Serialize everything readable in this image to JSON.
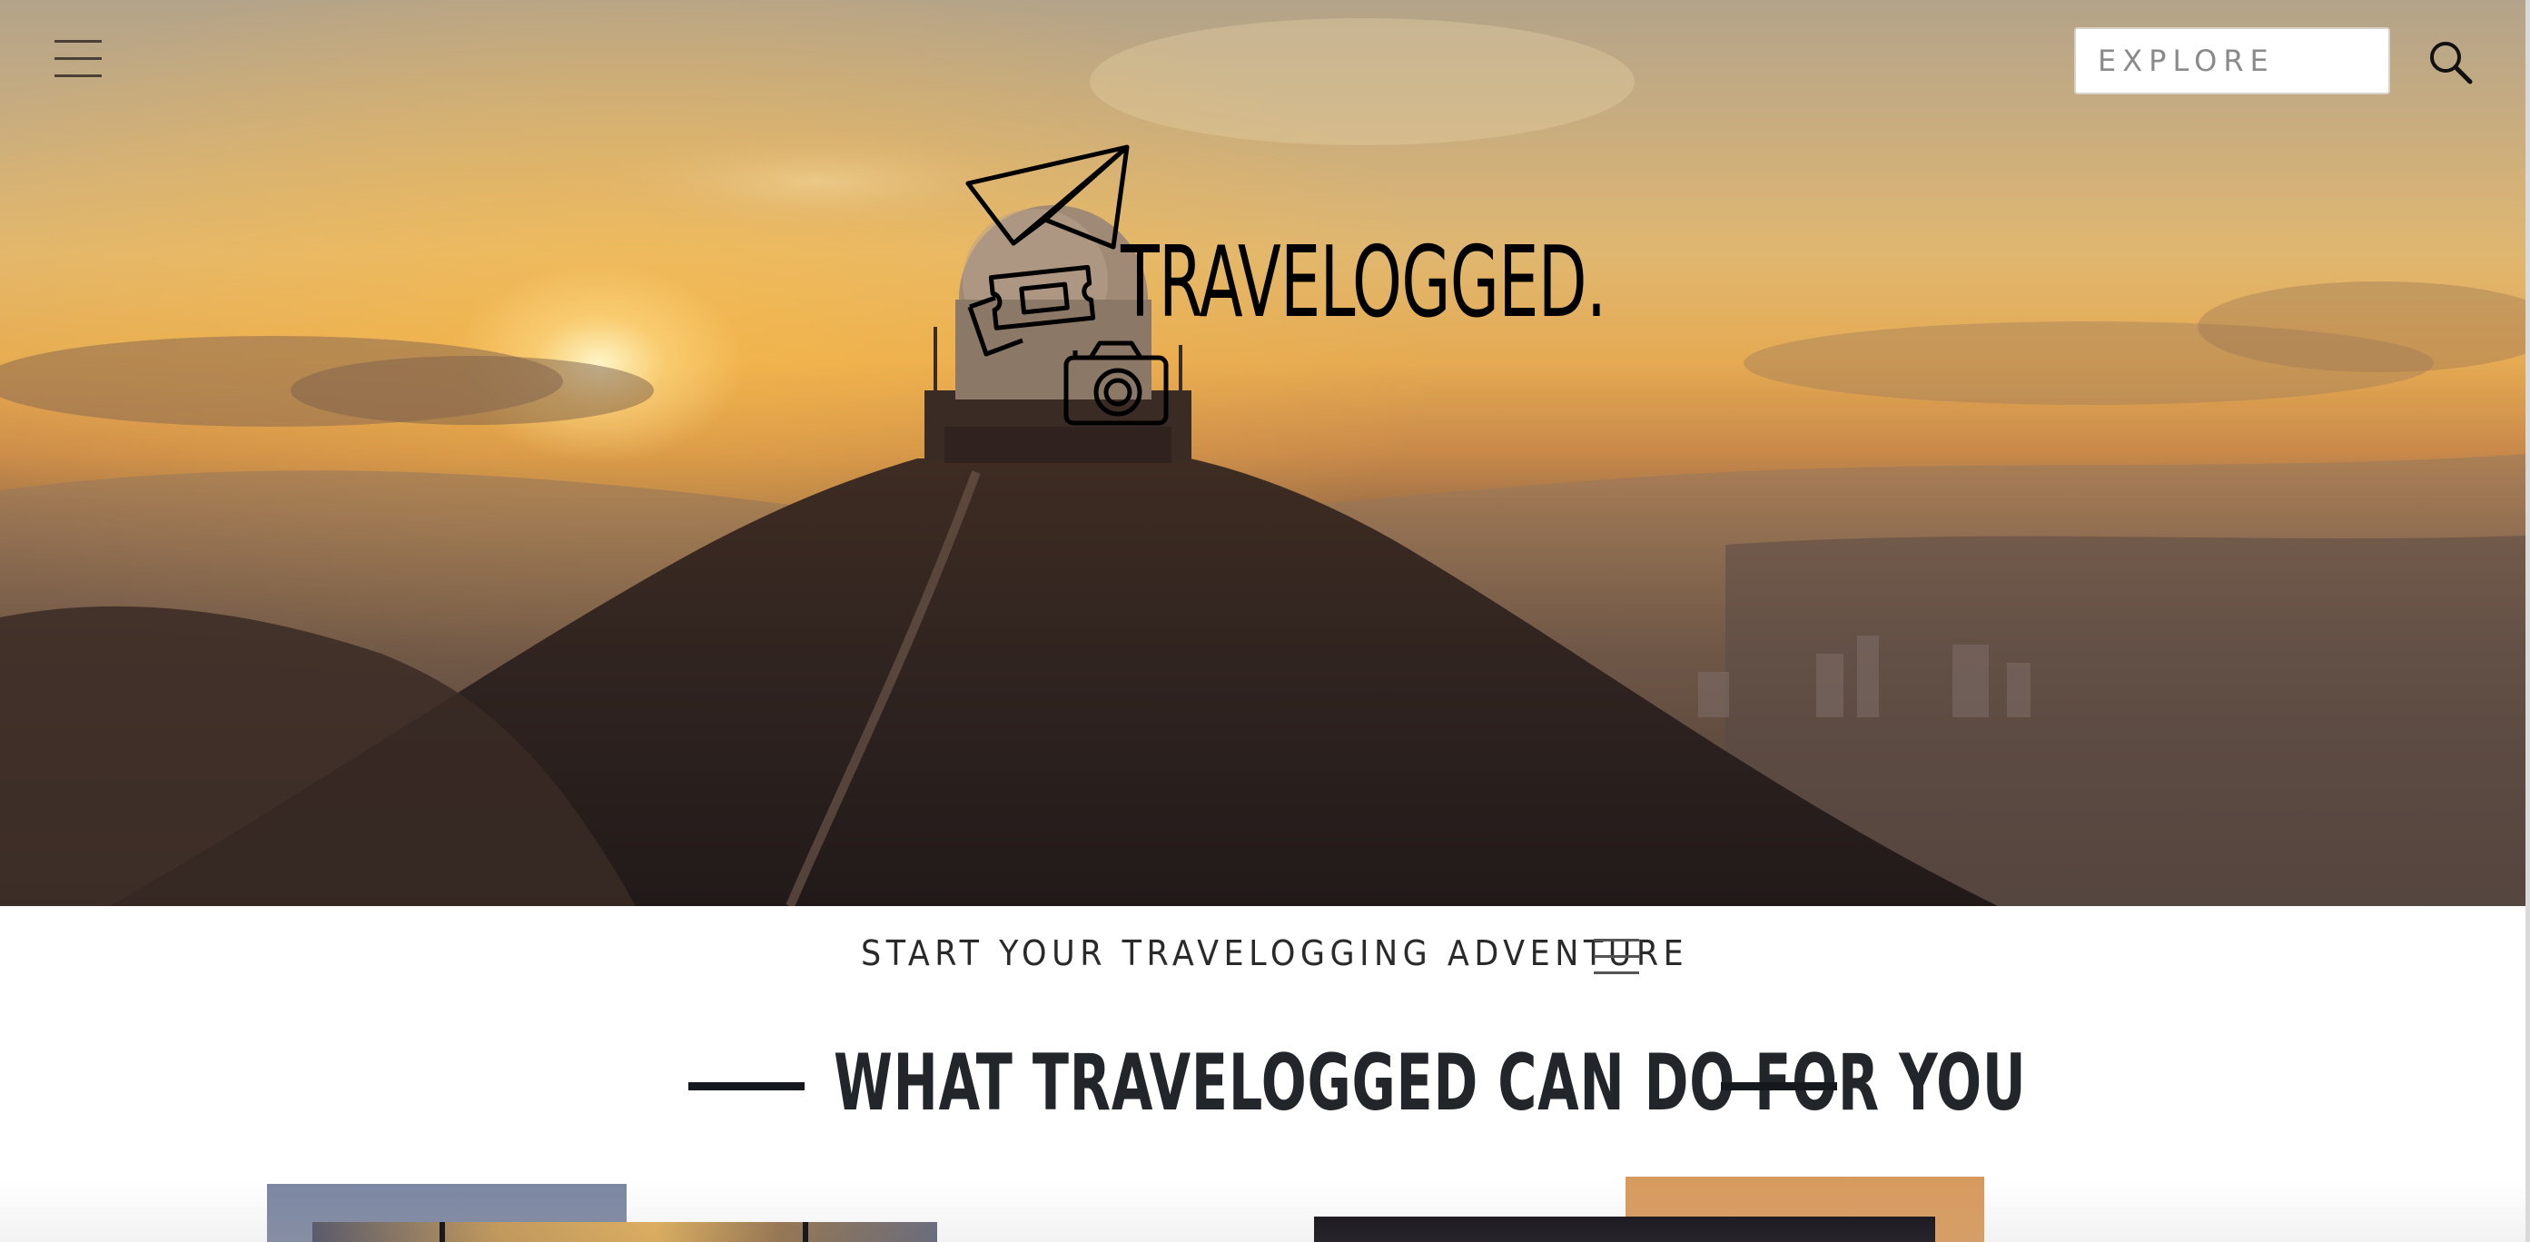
{
  "header": {
    "menu_icon": "hamburger-icon",
    "search": {
      "placeholder": "EXPLORE",
      "value": "",
      "icon": "search-icon"
    }
  },
  "hero": {
    "background": "sunset-over-mountain-with-radar-dome",
    "logo": {
      "wordmark": "TRAVELOGGED.",
      "icons": [
        "paper-plane-icon",
        "ticket-icon",
        "camera-icon"
      ]
    }
  },
  "subnav": {
    "label": "START YOUR TRAVELOGGING ADVENTURE",
    "menu_icon": "hamburger-icon"
  },
  "section": {
    "title": "WHAT TRAVELOGGED CAN DO FOR YOU"
  },
  "colors": {
    "text_dark": "#22262b",
    "heading_rule": "#15181c",
    "input_border": "#d8d2c8",
    "sky_gold": "#e5aa52"
  }
}
